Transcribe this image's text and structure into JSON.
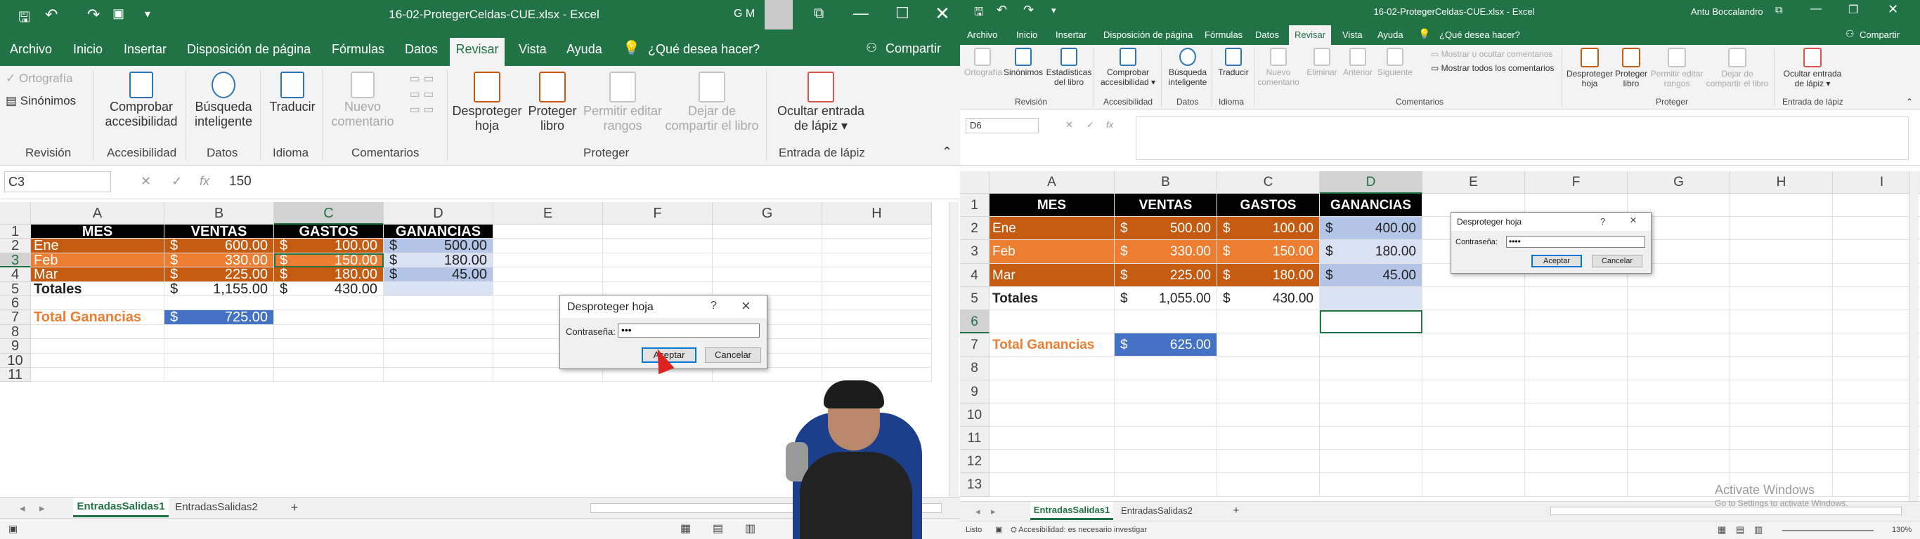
{
  "colors": {
    "excel_green": "#217346",
    "header_black": "#000000",
    "orange_dark": "#c55a11",
    "orange_light": "#ed7d31",
    "blue_light": "#b4c6e7",
    "blue_total": "#4472c4"
  },
  "left": {
    "title": "16-02-ProtegerCeldas-CUE.xlsx  -  Excel",
    "user": "G M",
    "menu": [
      "Archivo",
      "Inicio",
      "Insertar",
      "Disposición de página",
      "Fórmulas",
      "Datos",
      "Revisar",
      "Vista",
      "Ayuda"
    ],
    "tell_me": "¿Qué desea hacer?",
    "share": "Compartir",
    "ribbon": {
      "ortografia": "Ortografía",
      "sinonimos": "Sinónimos",
      "comprobar": "Comprobar accesibilidad",
      "busqueda": "Búsqueda inteligente",
      "traducir": "Traducir",
      "nuevo_comentario": "Nuevo comentario",
      "desproteger_hoja": "Desproteger hoja",
      "proteger_libro": "Proteger libro",
      "permitir": "Permitir editar rangos",
      "dejar": "Dejar de compartir el libro",
      "ocultar": "Ocultar entrada de lápiz",
      "groups": {
        "revision": "Revisión",
        "accesibilidad": "Accesibilidad",
        "datos": "Datos",
        "idioma": "Idioma",
        "comentarios": "Comentarios",
        "proteger": "Proteger",
        "entrada": "Entrada de lápiz"
      }
    },
    "name_box": "C3",
    "formula": "150",
    "fx": "fx",
    "columns": [
      "A",
      "B",
      "C",
      "D",
      "E",
      "F",
      "G",
      "H"
    ],
    "rows": [
      "1",
      "2",
      "3",
      "4",
      "5",
      "6",
      "7",
      "8",
      "9",
      "10",
      "11"
    ],
    "table": {
      "headers": [
        "MES",
        "VENTAS",
        "GASTOS",
        "GANANCIAS"
      ],
      "rows": [
        [
          "Ene",
          "$",
          "600.00",
          "$",
          "100.00",
          "$",
          "500.00"
        ],
        [
          "Feb",
          "$",
          "330.00",
          "$",
          "150.00",
          "$",
          "180.00"
        ],
        [
          "Mar",
          "$",
          "225.00",
          "$",
          "180.00",
          "$",
          "45.00"
        ]
      ],
      "totales": [
        "Totales",
        "$",
        "1,155.00",
        "$",
        "430.00"
      ],
      "total_ganancias": [
        "Total Ganancias",
        "$",
        "725.00"
      ]
    },
    "dialog": {
      "title": "Desproteger hoja",
      "help": "?",
      "close": "×",
      "label": "Contraseña:",
      "value": "•••",
      "ok": "Aceptar",
      "cancel": "Cancelar"
    },
    "tabs": [
      "EntradasSalidas1",
      "EntradasSalidas2"
    ],
    "add_sheet": "+"
  },
  "right": {
    "title": "16-02-ProtegerCeldas-CUE.xlsx  -  Excel",
    "user": "Antu Boccalandro",
    "menu": [
      "Archivo",
      "Inicio",
      "Insertar",
      "Disposición de página",
      "Fórmulas",
      "Datos",
      "Revisar",
      "Vista",
      "Ayuda"
    ],
    "tell_me": "¿Qué desea hacer?",
    "share": "Compartir",
    "ribbon": {
      "ortografia": "Ortografía",
      "sinonimos": "Sinónimos",
      "estadisticas": "Estadísticas del libro",
      "comprobar": "Comprobar accesibilidad",
      "busqueda": "Búsqueda inteligente",
      "traducir": "Traducir",
      "nuevo_comentario": "Nuevo comentario",
      "eliminar": "Eliminar",
      "anterior": "Anterior",
      "siguiente": "Siguiente",
      "mostrar_ocultar": "Mostrar u ocultar comentarios",
      "mostrar_todos": "Mostrar todos los comentarios",
      "desproteger_hoja": "Desproteger hoja",
      "proteger_libro": "Proteger libro",
      "permitir": "Permitir editar rangos",
      "dejar": "Dejar de compartir el libro",
      "ocultar": "Ocultar entrada de lápiz",
      "groups": {
        "revision": "Revisión",
        "accesibilidad": "Accesibilidad",
        "datos": "Datos",
        "idioma": "Idioma",
        "comentarios": "Comentarios",
        "proteger": "Proteger",
        "entrada": "Entrada de lápiz"
      }
    },
    "name_box": "D6",
    "fx": "fx",
    "columns": [
      "A",
      "B",
      "C",
      "D",
      "E",
      "F",
      "G",
      "H",
      "I"
    ],
    "rows": [
      "1",
      "2",
      "3",
      "4",
      "5",
      "6",
      "7",
      "8",
      "9",
      "10",
      "11",
      "12",
      "13"
    ],
    "table": {
      "headers": [
        "MES",
        "VENTAS",
        "GASTOS",
        "GANANCIAS"
      ],
      "rows": [
        [
          "Ene",
          "$",
          "500.00",
          "$",
          "100.00",
          "$",
          "400.00"
        ],
        [
          "Feb",
          "$",
          "330.00",
          "$",
          "150.00",
          "$",
          "180.00"
        ],
        [
          "Mar",
          "$",
          "225.00",
          "$",
          "180.00",
          "$",
          "45.00"
        ]
      ],
      "totales": [
        "Totales",
        "$",
        "1,055.00",
        "$",
        "430.00"
      ],
      "total_ganancias": [
        "Total Ganancias",
        "$",
        "625.00"
      ]
    },
    "dialog": {
      "title": "Desproteger hoja",
      "help": "?",
      "close": "×",
      "label": "Contraseña:",
      "value": "••••",
      "ok": "Aceptar",
      "cancel": "Cancelar"
    },
    "tabs": [
      "EntradasSalidas1",
      "EntradasSalidas2"
    ],
    "add_sheet": "+",
    "status": {
      "listo": "Listo",
      "accesibilidad": "Accesibilidad: es necesario investigar",
      "zoom": "130%"
    },
    "watermark_title": "Activate Windows",
    "watermark_sub": "Go to Settings to activate Windows."
  }
}
